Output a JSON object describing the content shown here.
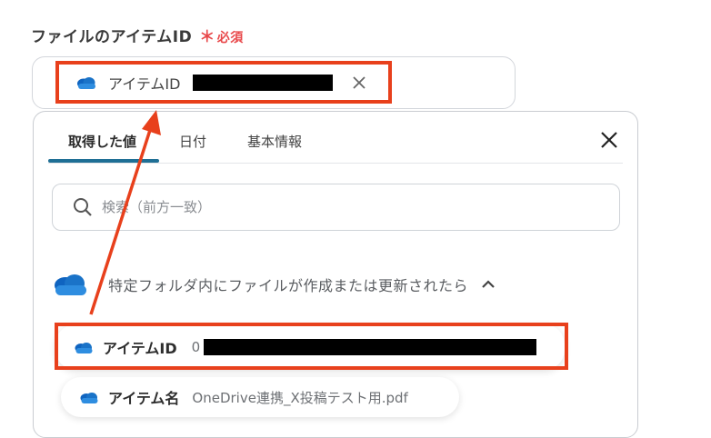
{
  "field": {
    "label": "ファイルのアイテムID",
    "required_star": "＊",
    "required_text": "必須"
  },
  "selected_chip": {
    "icon": "onedrive-cloud-icon",
    "label": "アイテムID"
  },
  "dropdown": {
    "tabs": [
      {
        "label": "取得した値",
        "active": true
      },
      {
        "label": "日付",
        "active": false
      },
      {
        "label": "基本情報",
        "active": false
      }
    ],
    "search_placeholder": "検索（前方一致）",
    "group": {
      "title": "特定フォルダ内にファイルが作成または更新されたら",
      "icon": "onedrive-cloud-icon",
      "expanded": true
    },
    "items": [
      {
        "name": "アイテムID",
        "value_prefix": "0",
        "value": ""
      },
      {
        "name": "アイテム名",
        "value": "OneDrive連携_X投稿テスト用.pdf"
      }
    ]
  },
  "colors": {
    "highlight": "#e8401c",
    "onedrive_blue": "#1a73c8",
    "tab_underline": "#1f6f95",
    "required": "#e8484a"
  }
}
